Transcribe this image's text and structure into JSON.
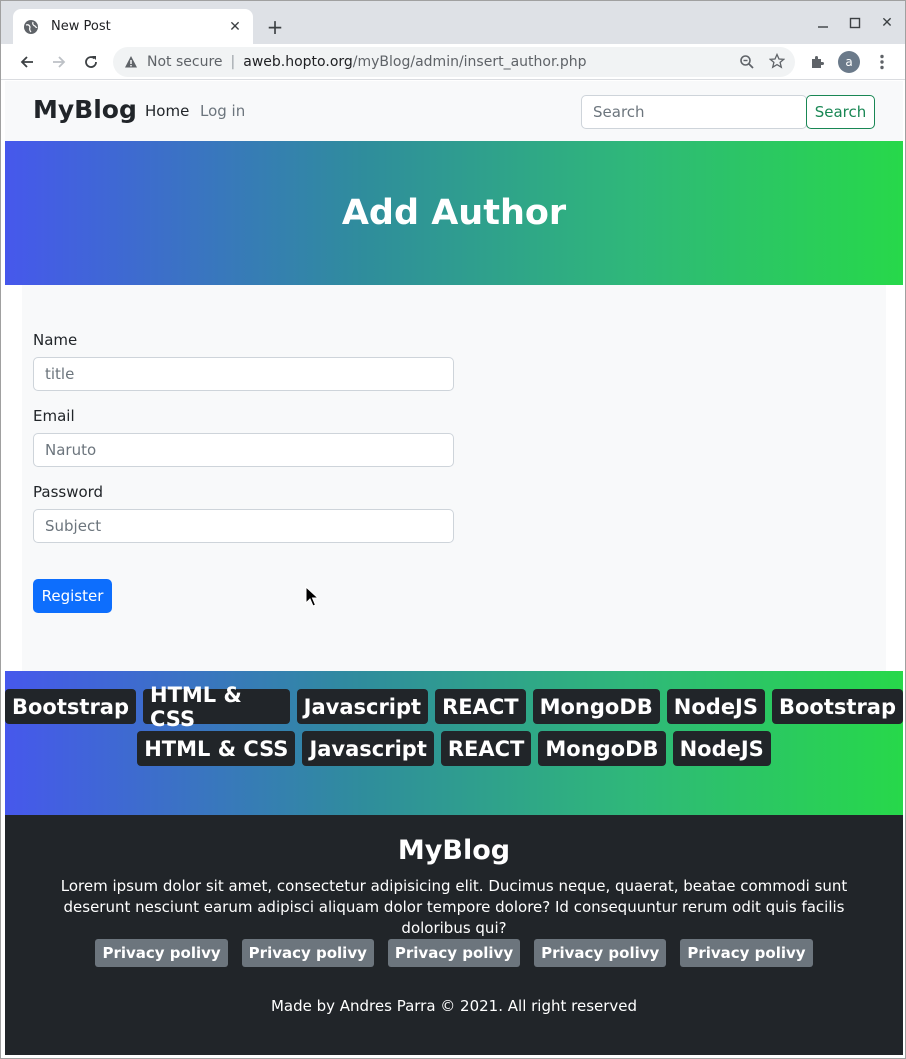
{
  "browser": {
    "tab_title": "New Post",
    "security_label": "Not secure",
    "url_host": "aweb.hopto.org",
    "url_path": "/myBlog/admin/insert_author.php",
    "profile_initial": "a"
  },
  "navbar": {
    "brand": "MyBlog",
    "links": [
      "Home",
      "Log in"
    ],
    "search_placeholder": "Search",
    "search_button": "Search"
  },
  "hero": {
    "title": "Add Author"
  },
  "form": {
    "fields": [
      {
        "label": "Name",
        "placeholder": "title",
        "value": ""
      },
      {
        "label": "Email",
        "placeholder": "Naruto",
        "value": ""
      },
      {
        "label": "Password",
        "placeholder": "Subject",
        "value": ""
      }
    ],
    "submit_label": "Register"
  },
  "tags": {
    "row1": [
      "Bootstrap",
      "HTML & CSS",
      "Javascript",
      "REACT",
      "MongoDB",
      "NodeJS",
      "Bootstrap"
    ],
    "row2": [
      "HTML & CSS",
      "Javascript",
      "REACT",
      "MongoDB",
      "NodeJS"
    ]
  },
  "footer": {
    "title": "MyBlog",
    "text": "Lorem ipsum dolor sit amet, consectetur adipisicing elit. Ducimus neque, quaerat, beatae commodi sunt deserunt nesciunt earum adipisci aliquam dolor tempore dolore? Id consequuntur rerum odit quis facilis doloribus qui?",
    "links": [
      "Privacy polivy",
      "Privacy polivy",
      "Privacy polivy",
      "Privacy polivy",
      "Privacy polivy"
    ],
    "copyright": "Made by Andres Parra © 2021. All right reserved"
  },
  "colors": {
    "primary": "#0d6efd",
    "success": "#198754",
    "dark": "#212529",
    "gradient_start": "#4658ec",
    "gradient_end": "#27d84a"
  }
}
